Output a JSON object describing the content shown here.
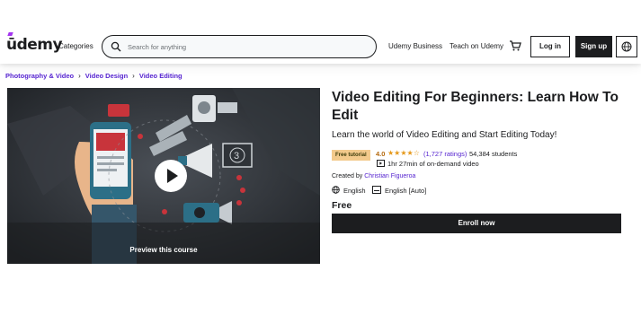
{
  "header": {
    "logo": "ūdemy",
    "categories_label": "Categories",
    "search_placeholder": "Search for anything",
    "business_label": "Udemy Business",
    "teach_label": "Teach on Udemy",
    "login_label": "Log in",
    "signup_label": "Sign up"
  },
  "breadcrumb": [
    "Photography & Video",
    "Video Design",
    "Video Editing"
  ],
  "preview": {
    "label": "Preview this course"
  },
  "course": {
    "title": "Video Editing For Beginners: Learn How To Edit",
    "subtitle": "Learn the world of Video Editing and Start Editing Today!",
    "badge": "Free tutorial",
    "rating": "4.0",
    "stars": "★★★★☆",
    "ratings_count": "(1,727 ratings)",
    "students": "54,384 students",
    "duration": "1hr 27min of on-demand video",
    "created_prefix": "Created by",
    "author": "Christian Figueroa",
    "language": "English",
    "captions": "English [Auto]",
    "price": "Free",
    "enroll_label": "Enroll now"
  },
  "colors": {
    "brand_purple": "#a435f0",
    "link_purple": "#5624d0",
    "rating_orange": "#b4690e",
    "star_color": "#e59819",
    "dark": "#1c1d1f",
    "badge_bg": "#f3ca8c"
  },
  "icons": [
    "search-icon",
    "cart-icon",
    "globe-icon",
    "play-icon",
    "video-icon",
    "closed-captions-icon"
  ]
}
